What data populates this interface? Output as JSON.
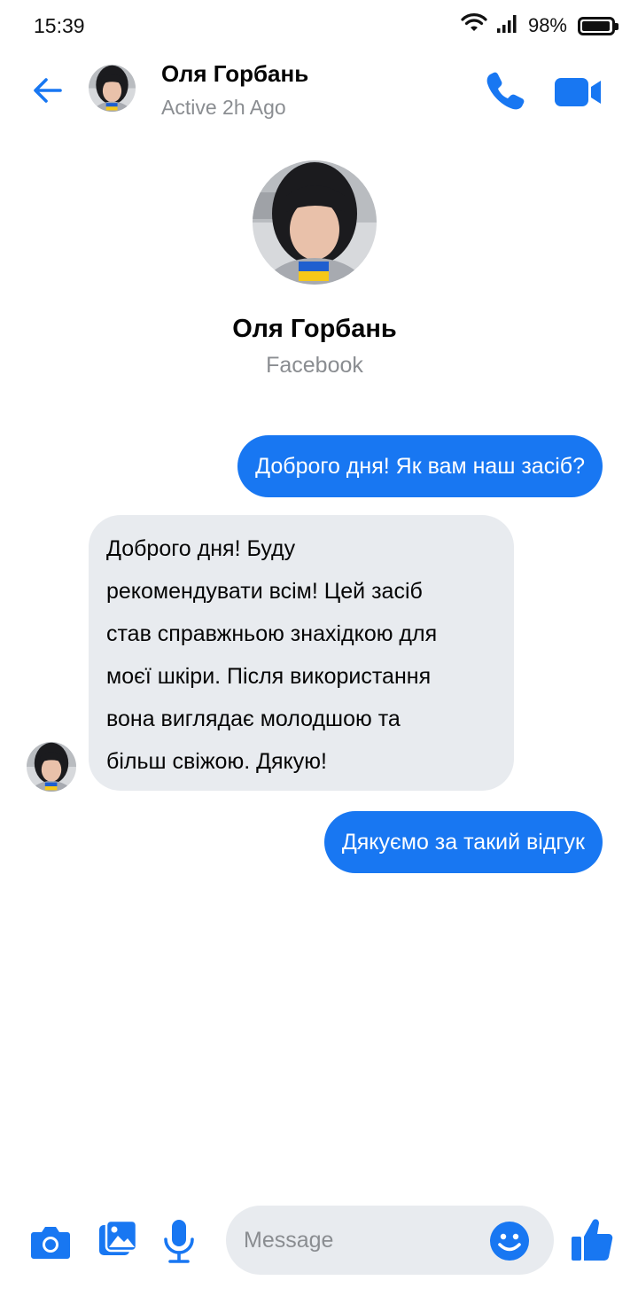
{
  "status_bar": {
    "time": "15:39",
    "battery_text": "98%",
    "battery_level": 0.98,
    "icons": [
      "wifi-icon",
      "signal-icon",
      "battery-icon"
    ]
  },
  "header": {
    "name": "Оля Горбань",
    "status": "Active 2h Ago",
    "icons": [
      "back-arrow-icon",
      "phone-icon",
      "video-camera-icon"
    ]
  },
  "profile": {
    "name": "Оля Горбань",
    "source": "Facebook"
  },
  "messages": [
    {
      "direction": "outgoing",
      "lines": [
        "Доброго дня! Як вам наш засіб?"
      ]
    },
    {
      "direction": "incoming",
      "lines": [
        "Доброго дня! Буду",
        "рекомендувати всім! Цей засіб",
        "став справжньою знахідкою для",
        "моєї шкіри. Після використання",
        "вона виглядає молодшою та",
        "більш свіжою. Дякую!"
      ]
    },
    {
      "direction": "outgoing",
      "lines": [
        "Дякуємо за такий відгук"
      ]
    }
  ],
  "composer": {
    "placeholder": "Message",
    "value": "",
    "icons": [
      "camera-icon",
      "gallery-icon",
      "microphone-icon",
      "emoji-icon",
      "thumbs-up-icon"
    ]
  },
  "colors": {
    "accent": "#1877f2",
    "incoming_bubble": "#e8ebef",
    "secondary_text": "#8a8d91"
  }
}
